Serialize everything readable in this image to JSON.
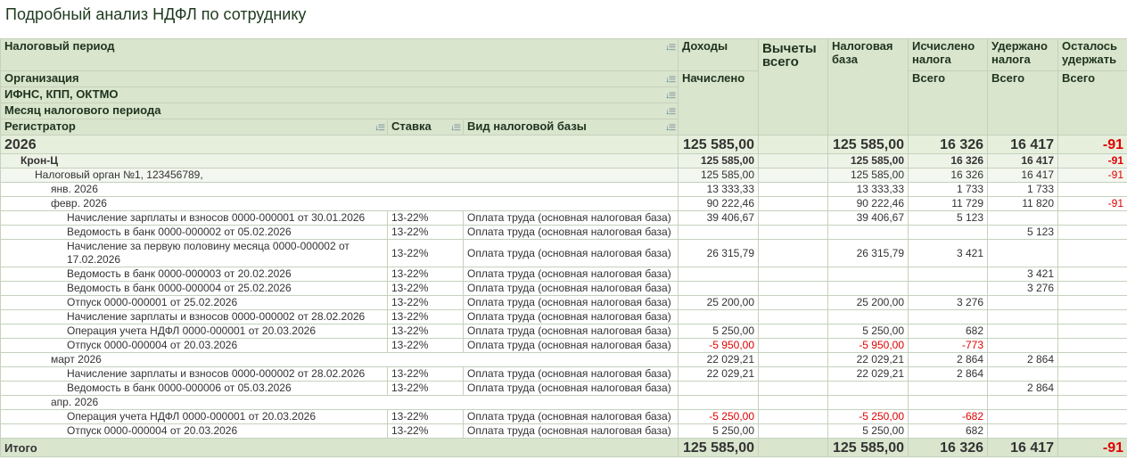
{
  "title": "Подробный анализ НДФЛ по сотруднику",
  "header": {
    "period": "Налоговый период",
    "org": "Организация",
    "ifns": "ИФНС, КПП, ОКТМО",
    "month": "Месяц налогового периода",
    "registrator": "Регистратор",
    "rate": "Ставка",
    "base_type": "Вид налоговой базы",
    "income": "Доходы",
    "accrued": "Начислено",
    "deductions": "Вычеты всего",
    "tax_base": "Налоговая база",
    "calculated": "Исчислено налога",
    "withheld": "Удержано налога",
    "remaining": "Осталось удержать",
    "total": "Всего"
  },
  "rows": [
    {
      "level": 0,
      "label": "2026",
      "vals": [
        "125 585,00",
        "",
        "125 585,00",
        "16 326",
        "16 417",
        "-91"
      ]
    },
    {
      "level": 1,
      "label": "Крон-Ц",
      "vals": [
        "125 585,00",
        "",
        "125 585,00",
        "16 326",
        "16 417",
        "-91"
      ]
    },
    {
      "level": 2,
      "label": "Налоговый орган №1, 123456789,",
      "vals": [
        "125 585,00",
        "",
        "125 585,00",
        "16 326",
        "16 417",
        "-91"
      ]
    },
    {
      "level": 3,
      "label": "янв. 2026",
      "vals": [
        "13 333,33",
        "",
        "13 333,33",
        "1 733",
        "1 733",
        ""
      ]
    },
    {
      "level": 3,
      "label": "февр. 2026",
      "vals": [
        "90 222,46",
        "",
        "90 222,46",
        "11 729",
        "11 820",
        "-91"
      ]
    },
    {
      "level": 4,
      "label": "Начисление зарплаты и взносов 0000-000001 от 30.01.2026",
      "rate": "13-22%",
      "base": "Оплата труда (основная налоговая база)",
      "vals": [
        "39 406,67",
        "",
        "39 406,67",
        "5 123",
        "",
        ""
      ]
    },
    {
      "level": 4,
      "label": "Ведомость в банк 0000-000002 от 05.02.2026",
      "rate": "13-22%",
      "base": "Оплата труда (основная налоговая база)",
      "vals": [
        "",
        "",
        "",
        "",
        "5 123",
        ""
      ]
    },
    {
      "level": 4,
      "label": "Начисление за первую половину месяца 0000-000002 от 17.02.2026",
      "rate": "13-22%",
      "base": "Оплата труда (основная налоговая база)",
      "vals": [
        "26 315,79",
        "",
        "26 315,79",
        "3 421",
        "",
        ""
      ],
      "wrap": true
    },
    {
      "level": 4,
      "label": "Ведомость в банк 0000-000003 от 20.02.2026",
      "rate": "13-22%",
      "base": "Оплата труда (основная налоговая база)",
      "vals": [
        "",
        "",
        "",
        "",
        "3 421",
        ""
      ]
    },
    {
      "level": 4,
      "label": "Ведомость в банк 0000-000004 от 25.02.2026",
      "rate": "13-22%",
      "base": "Оплата труда (основная налоговая база)",
      "vals": [
        "",
        "",
        "",
        "",
        "3 276",
        ""
      ]
    },
    {
      "level": 4,
      "label": "Отпуск 0000-000001 от 25.02.2026",
      "rate": "13-22%",
      "base": "Оплата труда (основная налоговая база)",
      "vals": [
        "25 200,00",
        "",
        "25 200,00",
        "3 276",
        "",
        ""
      ]
    },
    {
      "level": 4,
      "label": "Начисление зарплаты и взносов 0000-000002 от 28.02.2026",
      "rate": "13-22%",
      "base": "Оплата труда (основная налоговая база)",
      "vals": [
        "",
        "",
        "",
        "",
        "",
        ""
      ]
    },
    {
      "level": 4,
      "label": "Операция учета НДФЛ 0000-000001 от 20.03.2026",
      "rate": "13-22%",
      "base": "Оплата труда (основная налоговая база)",
      "vals": [
        "5 250,00",
        "",
        "5 250,00",
        "682",
        "",
        ""
      ]
    },
    {
      "level": 4,
      "label": "Отпуск 0000-000004 от 20.03.2026",
      "rate": "13-22%",
      "base": "Оплата труда (основная налоговая база)",
      "vals": [
        "-5 950,00",
        "",
        "-5 950,00",
        "-773",
        "",
        ""
      ]
    },
    {
      "level": 3,
      "label": "март 2026",
      "vals": [
        "22 029,21",
        "",
        "22 029,21",
        "2 864",
        "2 864",
        ""
      ]
    },
    {
      "level": 4,
      "label": "Начисление зарплаты и взносов 0000-000002 от 28.02.2026",
      "rate": "13-22%",
      "base": "Оплата труда (основная налоговая база)",
      "vals": [
        "22 029,21",
        "",
        "22 029,21",
        "2 864",
        "",
        ""
      ]
    },
    {
      "level": 4,
      "label": "Ведомость в банк 0000-000006 от 05.03.2026",
      "rate": "13-22%",
      "base": "Оплата труда (основная налоговая база)",
      "vals": [
        "",
        "",
        "",
        "",
        "2 864",
        ""
      ]
    },
    {
      "level": 3,
      "label": "апр. 2026",
      "vals": [
        "",
        "",
        "",
        "",
        "",
        ""
      ]
    },
    {
      "level": 4,
      "label": "Операция учета НДФЛ 0000-000001 от 20.03.2026",
      "rate": "13-22%",
      "base": "Оплата труда (основная налоговая база)",
      "vals": [
        "-5 250,00",
        "",
        "-5 250,00",
        "-682",
        "",
        ""
      ]
    },
    {
      "level": 4,
      "label": "Отпуск 0000-000004 от 20.03.2026",
      "rate": "13-22%",
      "base": "Оплата труда (основная налоговая база)",
      "vals": [
        "5 250,00",
        "",
        "5 250,00",
        "682",
        "",
        ""
      ]
    }
  ],
  "total": {
    "label": "Итого",
    "vals": [
      "125 585,00",
      "",
      "125 585,00",
      "16 326",
      "16 417",
      "-91"
    ]
  },
  "colors": {
    "header_bg": "#d9e5cd",
    "negative": "#e00000"
  }
}
